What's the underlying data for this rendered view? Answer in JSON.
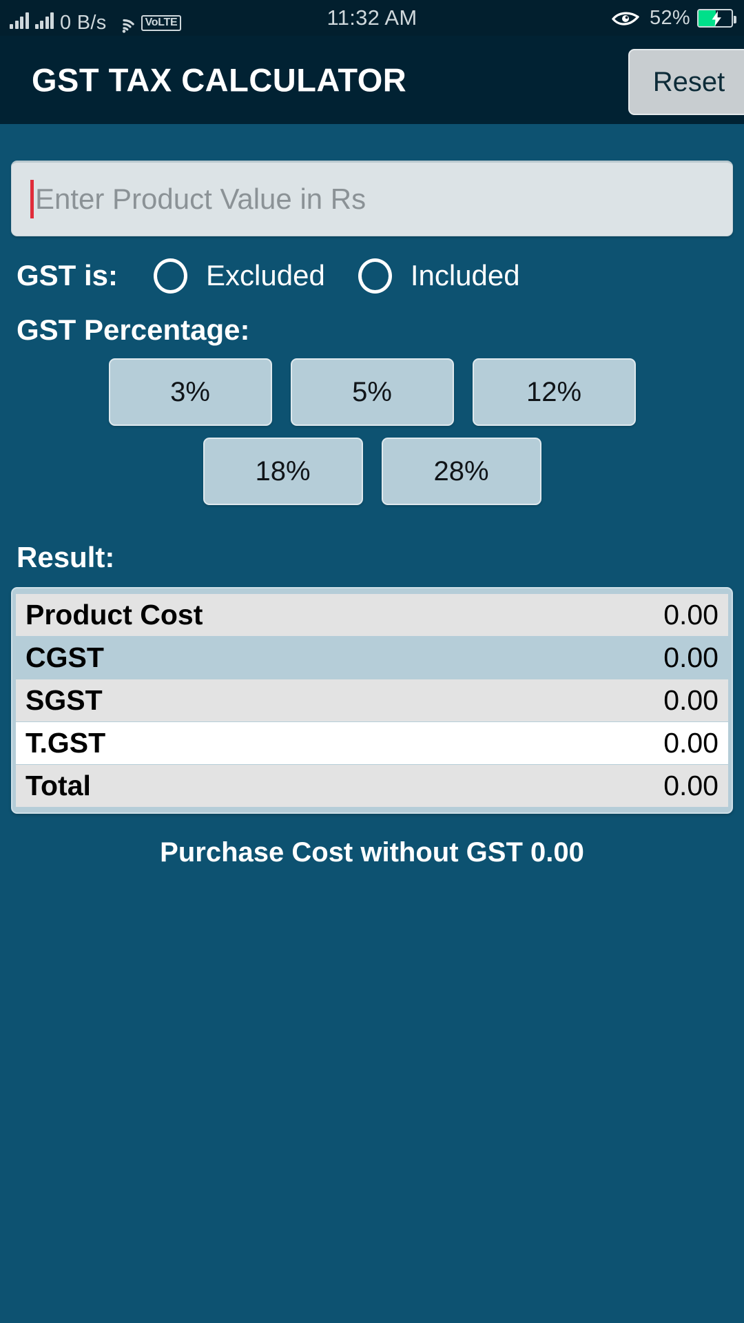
{
  "status_bar": {
    "network_speed": "0 B/s",
    "volte_badge": "VoLTE",
    "time": "11:32 AM",
    "battery_percent": "52%",
    "battery_level": 52,
    "battery_charging": true,
    "battery_fill_color": "#00e08a",
    "icons": [
      "signal-bars-icon",
      "signal-bars-icon",
      "wifi-icon",
      "volte-icon",
      "eye-care-icon",
      "battery-charging-icon"
    ]
  },
  "header": {
    "title": "GST TAX CALCULATOR",
    "reset_label": "Reset",
    "background_color": "#012233",
    "reset_background_color": "#c8cdd0"
  },
  "theme": {
    "page_background": "#0d5271",
    "field_background": "#dce3e6",
    "button_background": "#b5cdd8",
    "cursor_color": "#e02c3a",
    "row_gray": "#e3e3e3",
    "row_blue": "#b5cdd8",
    "row_white": "#ffffff"
  },
  "form": {
    "product_value": "",
    "product_value_placeholder": "Enter Product Value in Rs",
    "gst_mode_label": "GST is:",
    "gst_mode_options": [
      {
        "label": "Excluded",
        "selected": false
      },
      {
        "label": "Included",
        "selected": false
      }
    ],
    "gst_percentage_label": "GST Percentage:",
    "gst_percentage_options": [
      "3%",
      "5%",
      "12%",
      "18%",
      "28%"
    ],
    "gst_percentage_selected": ""
  },
  "result": {
    "label": "Result:",
    "rows": [
      {
        "name": "Product Cost",
        "value": "0.00",
        "row_style": "gray"
      },
      {
        "name": "CGST",
        "value": "0.00",
        "row_style": "blue"
      },
      {
        "name": "SGST",
        "value": "0.00",
        "row_style": "gray"
      },
      {
        "name": "T.GST",
        "value": "0.00",
        "row_style": "white"
      },
      {
        "name": "Total",
        "value": "0.00",
        "row_style": "gray"
      }
    ],
    "purchase_cost_note": "Purchase Cost without GST 0.00"
  }
}
